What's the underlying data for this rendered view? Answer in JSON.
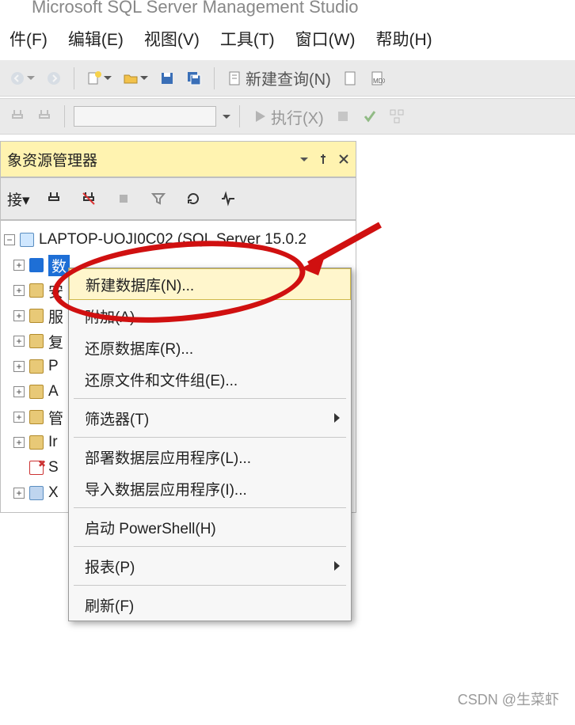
{
  "app": {
    "title": "Microsoft SQL Server Management Studio"
  },
  "menu": {
    "file": "件(F)",
    "edit": "编辑(E)",
    "view": "视图(V)",
    "tools": "工具(T)",
    "window": "窗口(W)",
    "help": "帮助(H)"
  },
  "toolbar": {
    "new_query": "新建查询(N)",
    "execute": "执行(X)"
  },
  "panel": {
    "title": "象资源管理器",
    "connect": "接▾"
  },
  "tree": {
    "server": "LAPTOP-UOJI0C02 (SQL Server 15.0.2",
    "items": [
      {
        "label": "数据库",
        "selected": true,
        "cut": "数"
      },
      {
        "label": "安",
        "selected": false
      },
      {
        "label": "服",
        "selected": false
      },
      {
        "label": "复",
        "selected": false
      },
      {
        "label": "P",
        "selected": false
      },
      {
        "label": "A",
        "selected": false
      },
      {
        "label": "管",
        "selected": false
      },
      {
        "label": "Ir",
        "selected": false
      },
      {
        "label": "S",
        "selected": false,
        "special": "sa"
      },
      {
        "label": "X",
        "selected": false,
        "icon2": true
      }
    ]
  },
  "context_menu": {
    "items": [
      {
        "label": "新建数据库(N)...",
        "highlight": true
      },
      {
        "label": "附加(A)..."
      },
      {
        "label": "还原数据库(R)..."
      },
      {
        "label": "还原文件和文件组(E)..."
      },
      {
        "sep": true
      },
      {
        "label": "筛选器(T)",
        "submenu": true
      },
      {
        "sep": true
      },
      {
        "label": "部署数据层应用程序(L)..."
      },
      {
        "label": "导入数据层应用程序(I)..."
      },
      {
        "sep": true
      },
      {
        "label": "启动 PowerShell(H)"
      },
      {
        "sep": true
      },
      {
        "label": "报表(P)",
        "submenu": true
      },
      {
        "sep": true
      },
      {
        "label": "刷新(F)"
      }
    ]
  },
  "watermark": "CSDN @生菜虾"
}
